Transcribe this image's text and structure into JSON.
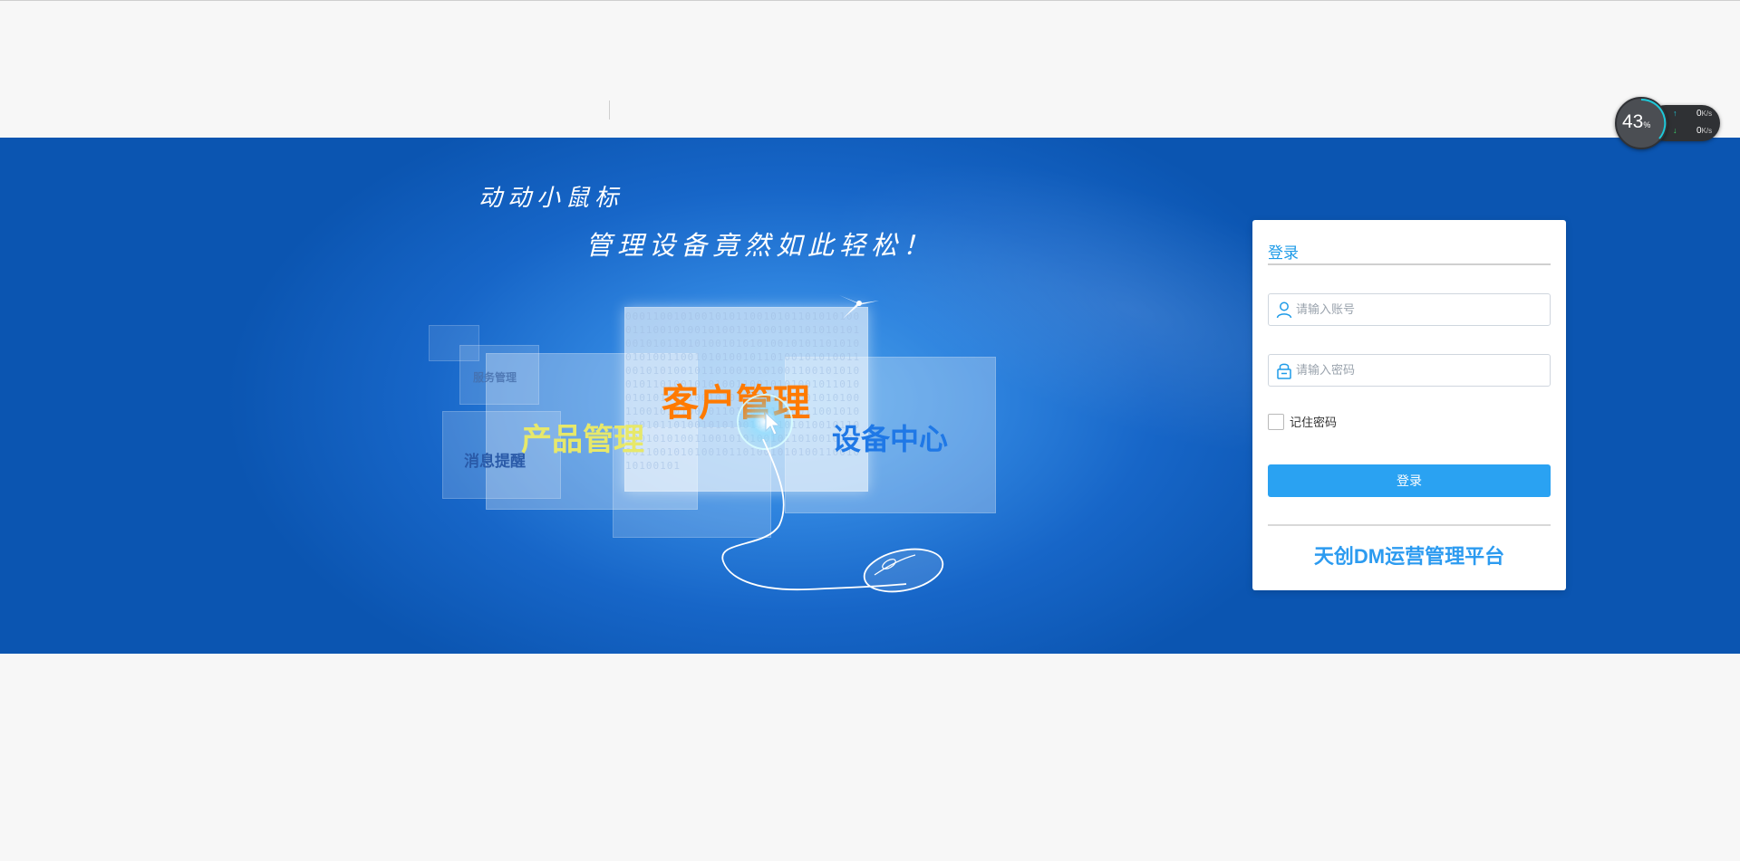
{
  "banner": {
    "tagline_line1": "动动小鼠标",
    "tagline_line2": "管理设备竟然如此轻松！",
    "modules": {
      "customer": "客户管理",
      "product": "产品管理",
      "device": "设备中心",
      "message": "消息提醒",
      "service": "服务管理"
    },
    "binary_text": "0001100101001010110010101101010100011100101001010011010010110101010100101011010100101010100101011010100101001100101010010110100101010011001010100101101001010100110010101001011010010101001100101010010110100101010011001010100101101001010100110010101001011010010101001100101010010110100101010011001010100101101001010100110010101001011010010101001100101010010110100101010011001010100101"
  },
  "login": {
    "title": "登录",
    "username_placeholder": "请输入账号",
    "username_value": "",
    "password_placeholder": "请输入密码",
    "password_value": "",
    "remember_label": "记住密码",
    "remember_checked": false,
    "submit_label": "登录",
    "platform_name": "天创DM运营管理平台"
  },
  "net_widget": {
    "percent": "43",
    "percent_sign": "%",
    "upload_value": "0",
    "download_value": "0",
    "unit": "K/s"
  },
  "colors": {
    "brand_blue": "#2aa2f2",
    "banner_blue": "#0b55b1",
    "customer_orange": "#ff7a00",
    "product_yellow": "#e7e86a",
    "device_blue": "#1f78e6"
  }
}
